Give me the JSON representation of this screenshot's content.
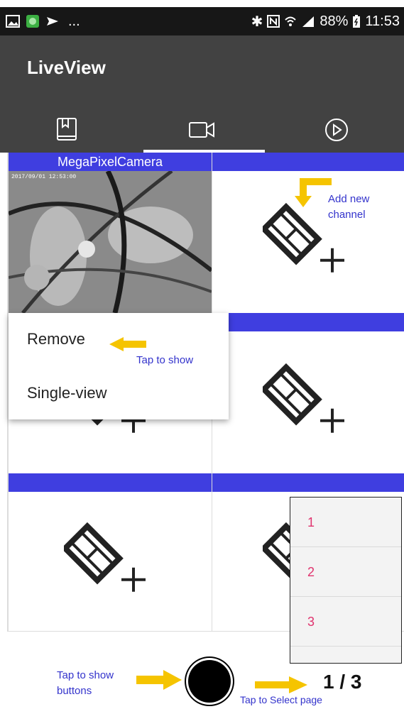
{
  "status_bar": {
    "overflow": "...",
    "battery": "88%",
    "time": "11:53",
    "icons": [
      "image-icon",
      "app-icon",
      "mail-icon",
      "bluetooth-icon",
      "nfc-icon",
      "wifi-icon",
      "signal-icon",
      "battery-icon"
    ]
  },
  "app_bar": {
    "title": "LiveView",
    "tabs": [
      {
        "icon": "bookmark-icon",
        "active": false
      },
      {
        "icon": "video-camera-icon",
        "active": true
      },
      {
        "icon": "play-icon",
        "active": false
      }
    ]
  },
  "grid": {
    "camera_name": "MegaPixelCamera",
    "camera_timestamp": "2017/09/01 12:53:00",
    "bar_color": "#3f3ee0",
    "add_icon": "film-add-icon"
  },
  "context_menu": {
    "remove_label": "Remove",
    "single_view_label": "Single-view"
  },
  "page_menu": {
    "items": [
      "1",
      "2",
      "3"
    ],
    "item_color": "#e0336e"
  },
  "annotations": {
    "add_new_channel": "Add new channel",
    "tap_to_show": "Tap to show",
    "tap_to_show_buttons": "Tap to show buttons",
    "tap_to_select_page": "Tap to Select page",
    "annotation_color": "#3333cc",
    "arrow_color": "#f5c400"
  },
  "page_indicator": "1 / 3"
}
